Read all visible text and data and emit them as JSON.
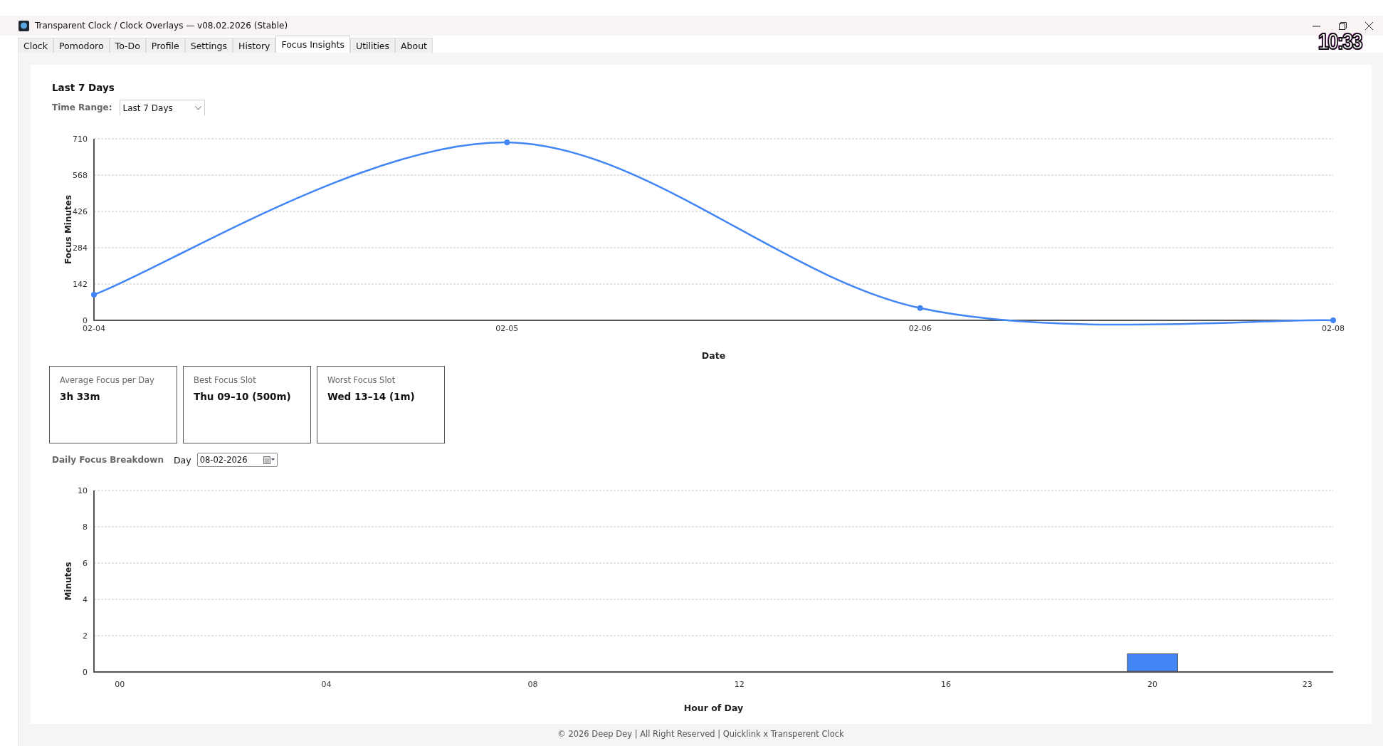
{
  "window": {
    "title": "Transparent Clock / Clock Overlays — v08.02.2026 (Stable)"
  },
  "tabs": [
    {
      "label": "Clock",
      "selected": false
    },
    {
      "label": "Pomodoro",
      "selected": false
    },
    {
      "label": "To-Do",
      "selected": false
    },
    {
      "label": "Profile",
      "selected": false
    },
    {
      "label": "Settings",
      "selected": false
    },
    {
      "label": "History",
      "selected": false
    },
    {
      "label": "Focus Insights",
      "selected": true
    },
    {
      "label": "Utilities",
      "selected": false
    },
    {
      "label": "About",
      "selected": false
    }
  ],
  "clock_overlay": {
    "time": "10:33"
  },
  "insights": {
    "heading": "Last 7 Days",
    "time_range": {
      "label": "Time Range:",
      "value": "Last 7 Days"
    },
    "trend_chart": {
      "chart_data": {
        "type": "line",
        "xlabel": "Date",
        "ylabel": "Focus Minutes",
        "categories": [
          "02-04",
          "02-05",
          "02-06",
          "02-08"
        ],
        "series": [
          {
            "color": "#4285f4",
            "marker": true,
            "values": [
              100,
              696,
              48,
              0
            ]
          }
        ],
        "grid": true,
        "ylim": [
          0,
          710
        ],
        "yticks": [
          0,
          142,
          284,
          426,
          568,
          710
        ]
      }
    },
    "cards": [
      {
        "label": "Average Focus per Day",
        "value": "3h 33m"
      },
      {
        "label": "Best Focus Slot",
        "value": "Thu 09–10 (500m)"
      },
      {
        "label": "Worst Focus Slot",
        "value": "Wed 13–14 (1m)"
      }
    ],
    "daily": {
      "label": "Daily Focus Breakdown",
      "day_label": "Day",
      "day_value": "08-02-2026"
    },
    "hourly_chart": {
      "chart_data": {
        "type": "bar",
        "xlabel": "Hour of Day",
        "ylabel": "Minutes",
        "x": [
          20
        ],
        "series": [
          {
            "color": "#4285f4",
            "values": [
              1
            ]
          }
        ],
        "grid": true,
        "xlim": [
          -0.5,
          23.5
        ],
        "ylim": [
          0,
          10
        ],
        "yticks": [
          0,
          2,
          4,
          6,
          8,
          10
        ],
        "xticks": [
          {
            "value": 0,
            "label": "00"
          },
          {
            "value": 4,
            "label": "04"
          },
          {
            "value": 8,
            "label": "08"
          },
          {
            "value": 12,
            "label": "12"
          },
          {
            "value": 16,
            "label": "16"
          },
          {
            "value": 20,
            "label": "20"
          },
          {
            "value": 23,
            "label": "23"
          }
        ]
      }
    }
  },
  "footer": "© 2026 Deep Dey | All Right Reserved | Quicklink x Transperent Clock"
}
